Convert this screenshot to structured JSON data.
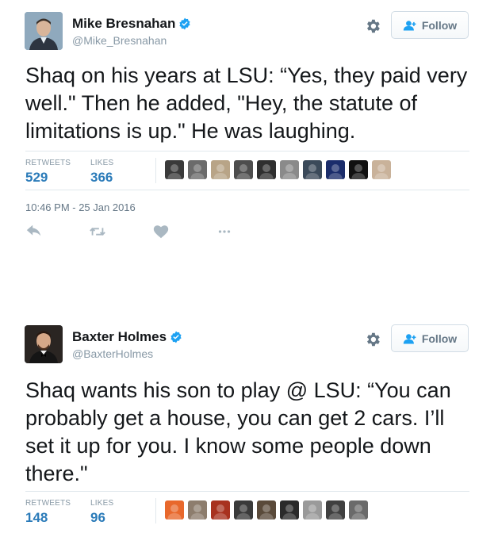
{
  "tweets": [
    {
      "display_name": "Mike Bresnahan",
      "handle": "@Mike_Bresnahan",
      "verified": true,
      "follow_label": "Follow",
      "text": "Shaq on his years at LSU: “Yes, they paid very well.\" Then he added, \"Hey, the statute of limitations is up.\" He was laughing.",
      "stats": {
        "retweets_label": "RETWEETS",
        "retweets": "529",
        "likes_label": "LIKES",
        "likes": "366"
      },
      "timestamp": "10:46 PM - 25 Jan 2016",
      "liker_avatar_colors": [
        "#3a3a3a",
        "#6b6b6b",
        "#b8a487",
        "#4d4d4d",
        "#2f2f2f",
        "#8a8a8a",
        "#3b4a5a",
        "#1b2d6b",
        "#111111",
        "#c9b29a"
      ],
      "actions": [
        "reply-icon",
        "retweet-icon",
        "like-icon",
        "more-icon"
      ]
    },
    {
      "display_name": "Baxter Holmes",
      "handle": "@BaxterHolmes",
      "verified": true,
      "follow_label": "Follow",
      "text": "Shaq wants his son to play @ LSU: “You can probably get a house, you can get 2 cars. I’ll set it up for you. I know some people down there.\"",
      "stats": {
        "retweets_label": "RETWEETS",
        "retweets": "148",
        "likes_label": "LIKES",
        "likes": "96"
      },
      "liker_avatar_colors": [
        "#e8682c",
        "#8d7d6d",
        "#a8321f",
        "#3a3a3a",
        "#5a4a3a",
        "#2a2a2a",
        "#9a9a9a",
        "#404040",
        "#6a6a6a"
      ]
    }
  ],
  "colors": {
    "accent": "#2b7bb9",
    "verified": "#1da1f2",
    "muted": "#8899a6",
    "border": "#e1e8ed"
  }
}
